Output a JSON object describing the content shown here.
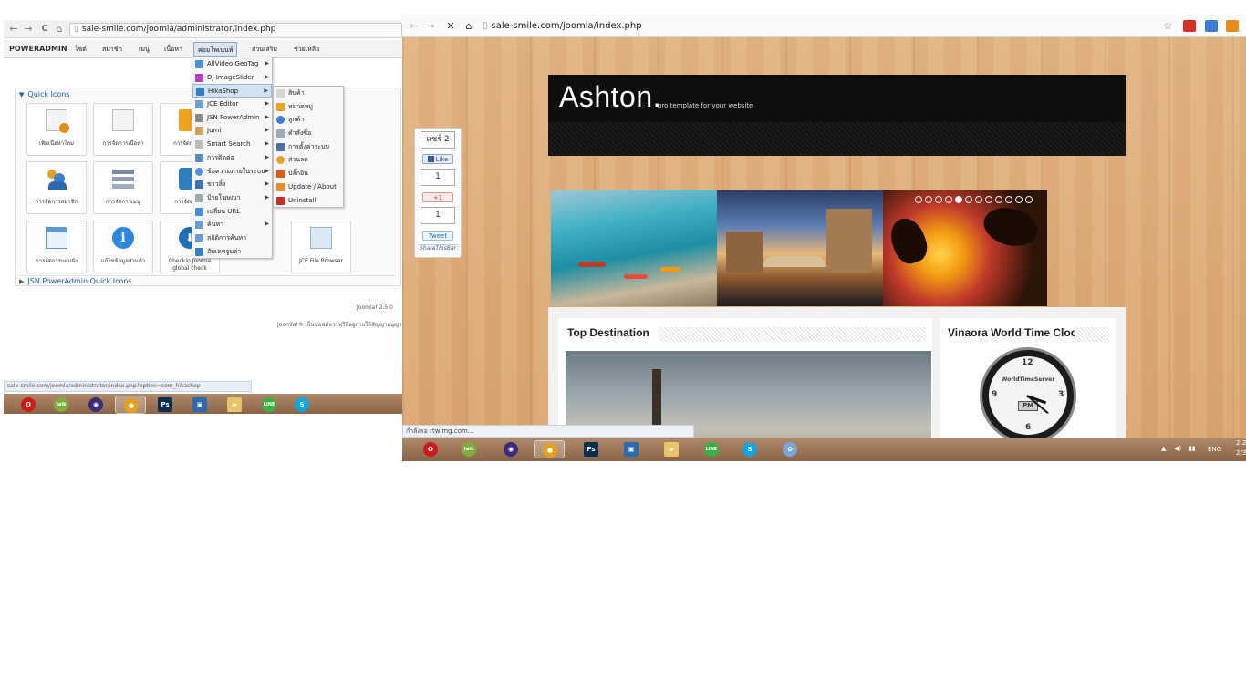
{
  "left": {
    "browser": {
      "url": "sale-smile.com/joomla/administrator/index.php",
      "back": "←",
      "forward": "→",
      "reload": "C",
      "home": "⌂"
    },
    "menu": {
      "brand": "POWERADMIN",
      "items": [
        "ไซต์",
        "สมาชิก",
        "เมนู",
        "เนื้อหา",
        "คอมโพเนนท์",
        "ส่วนเสริม",
        "ช่วยเหลือ"
      ]
    },
    "panel": {
      "header": "Quick Icons",
      "footer_section": "JSN PowerAdmin Quick Icons",
      "tiles": [
        {
          "label": "เพิ่มเนื้อหาใหม่",
          "color": "#e8a020"
        },
        {
          "label": "การจัดการเนื้อหา",
          "color": "#c9c9c9"
        },
        {
          "label": "การจัดการเ...",
          "color": "#f0a020"
        },
        {
          "label": "การจัดการสมาชิก",
          "color": "#3a7bd5"
        },
        {
          "label": "การจัดการเมนู",
          "color": "#7c8aa0"
        },
        {
          "label": "การจัดการ...",
          "color": "#2d7fc1"
        },
        {
          "label": "การจัดการแผนผัง",
          "color": "#5a9bd5"
        },
        {
          "label": "แก้ไขข้อมูลส่วนตัว",
          "color": "#2e86de"
        },
        {
          "label": "Checkin Joomla",
          "label2": "global check",
          "color": "#1d6fb8"
        },
        {
          "label": "JCE File Browser",
          "color": "#8fb8d8"
        }
      ]
    },
    "dropdown": {
      "items": [
        {
          "label": "AllVideo GeoTag",
          "arrow": true
        },
        {
          "label": "DJ-ImageSlider",
          "arrow": true
        },
        {
          "label": "HikaShop",
          "arrow": true,
          "highlight": true
        },
        {
          "label": "JCE Editor",
          "arrow": true
        },
        {
          "label": "JSN PowerAdmin",
          "arrow": true
        },
        {
          "label": "Jumi",
          "arrow": true
        },
        {
          "label": "Smart Search",
          "arrow": true
        },
        {
          "label": "การติดต่อ",
          "arrow": true
        },
        {
          "label": "ข้อความภายในระบบ",
          "arrow": true
        },
        {
          "label": "ข่าวลิ้ง",
          "arrow": true
        },
        {
          "label": "ป้ายโฆษณา",
          "arrow": true
        },
        {
          "label": "เปลี่ยน URL",
          "arrow": false
        },
        {
          "label": "ค้นหา",
          "arrow": true
        },
        {
          "label": "สถิติการค้นหา",
          "arrow": false
        },
        {
          "label": "อัพเดทจูมล่า",
          "arrow": false
        }
      ]
    },
    "submenu": {
      "items": [
        "สินค้า",
        "หมวดหมู่",
        "ลูกค้า",
        "คำสั่งซื้อ",
        "การตั้งค่าระบบ",
        "ส่วนลด",
        "ปลั๊กอิน",
        "Update / About",
        "Uninstall"
      ]
    },
    "version": "Joomla! 2.5.0",
    "copyright": "Joomla!® เป็นซอฟต์แวร์ฟรีที่อยู่ภายใต้สัญญาอนุญาต GNU",
    "status_url": "sale-smile.com/joomla/administrator/index.php?option=com_hikashop"
  },
  "right": {
    "browser": {
      "url": "sale-smile.com/joomla/index.php",
      "back": "←",
      "forward": "→",
      "stop": "✕",
      "home": "⌂"
    },
    "site": {
      "title": "Ashton.",
      "tagline": "pro template for your website"
    },
    "share": {
      "count_top": "แชร์ 2",
      "fb": "Like",
      "count_mid": "1",
      "gplus": "+1",
      "count_bottom": "1",
      "tweet": "Tweet",
      "brand": "ShareThisBar"
    },
    "boxes": {
      "left_title": "Top Destination",
      "right_title": "Vinaora World Time Clock",
      "clock_brand": "WorldTimeServer",
      "clock_ampm": "PM",
      "clock_numbers": [
        "12",
        "3",
        "6",
        "9"
      ]
    },
    "status_text": "กำลังรอ rtwimg.com...",
    "tray": {
      "lang": "ENG",
      "time": "2:2",
      "date": "2/3"
    }
  },
  "taskbar": {
    "apps": [
      {
        "name": "opera",
        "glyph": "O",
        "color": "#cc1a1a"
      },
      {
        "name": "gtalk",
        "glyph": "talk",
        "color": "#7fae3f"
      },
      {
        "name": "eclipse",
        "glyph": "◉",
        "color": "#3b2b7a"
      },
      {
        "name": "chrome",
        "glyph": "●",
        "color": "#e4a31c"
      },
      {
        "name": "photoshop",
        "glyph": "Ps",
        "color": "#0b2d4f"
      },
      {
        "name": "remote",
        "glyph": "▣",
        "color": "#2c6ab0"
      },
      {
        "name": "folder",
        "glyph": "▰",
        "color": "#e9c46a"
      },
      {
        "name": "line",
        "glyph": "LINE",
        "color": "#3cb043"
      },
      {
        "name": "skype",
        "glyph": "S",
        "color": "#12a5e6"
      },
      {
        "name": "paint",
        "glyph": "✿",
        "color": "#7aa6d8"
      }
    ]
  }
}
